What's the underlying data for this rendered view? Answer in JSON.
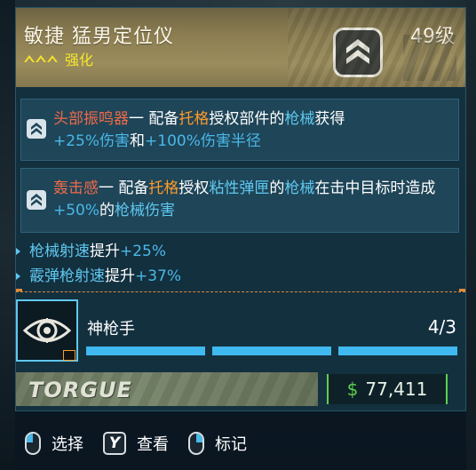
{
  "item": {
    "name": "敏捷 猛男定位仪",
    "level": "49级",
    "rarity": "强化",
    "rarity_color": "#f6e62e"
  },
  "perks": [
    {
      "icon": "chevron-badge-icon",
      "parts": [
        {
          "text": "头部振鸣器",
          "style": "red"
        },
        {
          "text": "一 配备",
          "style": "plain"
        },
        {
          "text": "托格",
          "style": "orange"
        },
        {
          "text": "授权部件的",
          "style": "plain"
        },
        {
          "text": "枪械",
          "style": "blue"
        },
        {
          "text": "获得",
          "style": "plain"
        },
        {
          "text": "+25%伤害",
          "style": "stat"
        },
        {
          "text": "和",
          "style": "plain"
        },
        {
          "text": "+100%伤害半径",
          "style": "stat"
        }
      ]
    },
    {
      "icon": "chevron-badge-icon",
      "parts": [
        {
          "text": "轰击感",
          "style": "red"
        },
        {
          "text": "一 配备",
          "style": "plain"
        },
        {
          "text": "托格",
          "style": "orange"
        },
        {
          "text": "授权",
          "style": "plain"
        },
        {
          "text": "粘性弹匣",
          "style": "blue"
        },
        {
          "text": "的",
          "style": "plain"
        },
        {
          "text": "枪械",
          "style": "blue"
        },
        {
          "text": "在击中目标时造成",
          "style": "plain"
        },
        {
          "text": "+50%",
          "style": "stat"
        },
        {
          "text": "的",
          "style": "plain"
        },
        {
          "text": "枪械伤害",
          "style": "blue"
        }
      ]
    }
  ],
  "stats": [
    {
      "name": "枪械射速",
      "verb": "提升",
      "value": "+25%"
    },
    {
      "name": "霰弹枪射速",
      "verb": "提升",
      "value": "+37%"
    }
  ],
  "skill": {
    "name": "神枪手",
    "count": "4/3",
    "icon": "eye-target-icon",
    "bars_filled": 3,
    "bars_total": 3
  },
  "manufacturer": {
    "logo_text": "TORGUE"
  },
  "price": {
    "symbol": "$",
    "value": "77,411"
  },
  "actions": [
    {
      "key": "mouse-left-icon",
      "label": "选择"
    },
    {
      "key": "Y",
      "label": "查看"
    },
    {
      "key": "mouse-right-icon",
      "label": "标记"
    }
  ],
  "colors": {
    "accent_blue": "#5fc8ef",
    "perk_name_red": "#f06a4a",
    "manufacturer_orange": "#ff9a2b",
    "price_green": "#5fcf4e"
  }
}
